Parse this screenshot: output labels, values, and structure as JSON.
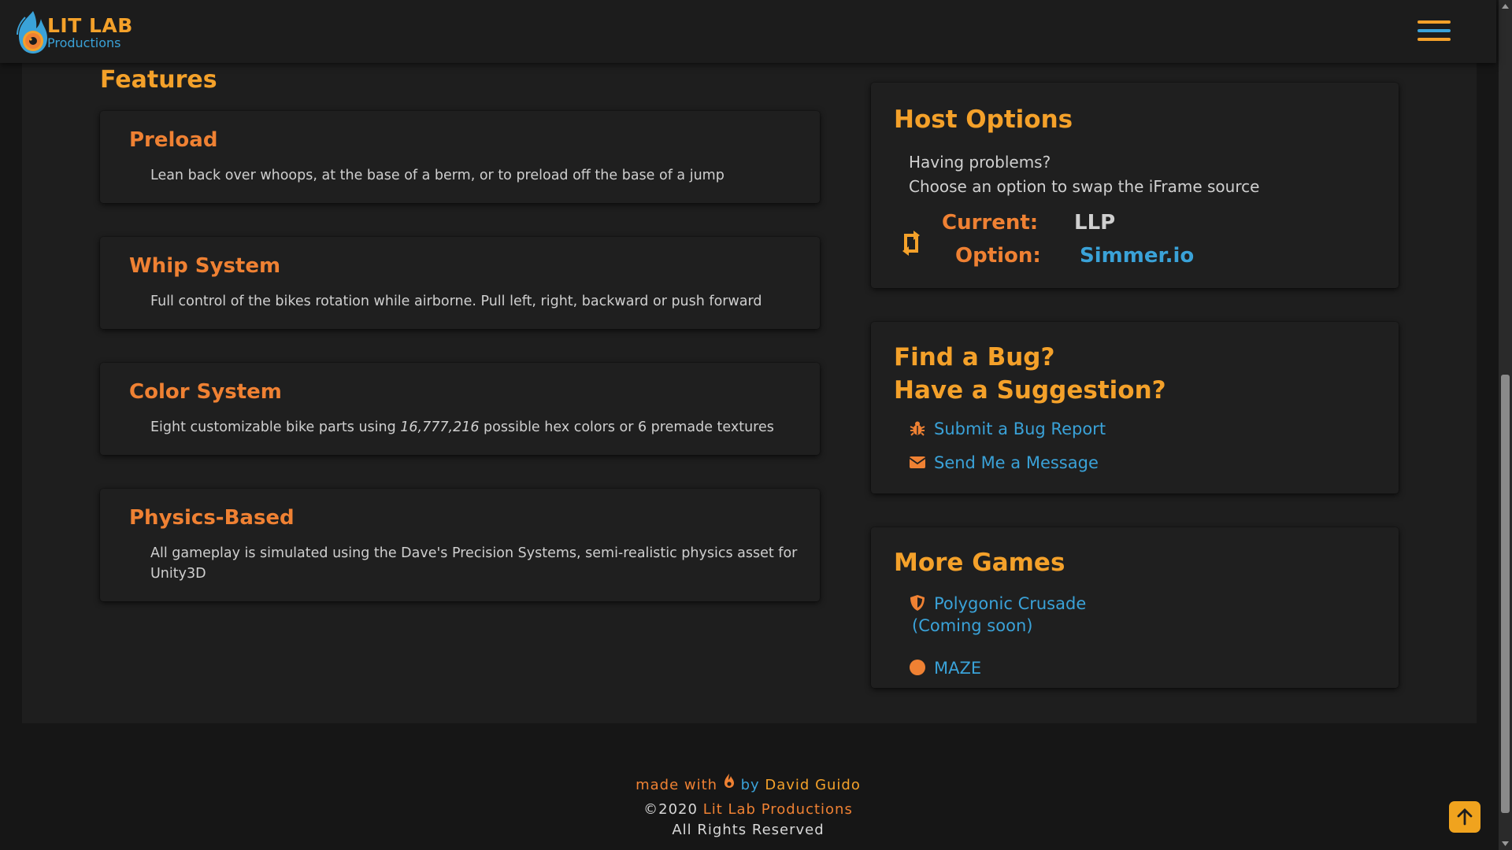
{
  "header": {
    "logo_title": "LIT LAB",
    "logo_subtitle": "Productions",
    "menu_icon": "hamburger-icon"
  },
  "features": {
    "heading": "Features",
    "items": [
      {
        "title": "Preload",
        "desc": "Lean back over whoops, at the base of a berm, or to preload off the base of a jump"
      },
      {
        "title": "Whip System",
        "desc": "Full control of the bikes rotation while airborne. Pull left, right, backward or push forward"
      },
      {
        "title": "Color System",
        "desc_before": "Eight customizable bike parts using ",
        "desc_em": "16,777,216",
        "desc_after": " possible hex colors or 6 premade textures"
      },
      {
        "title": "Physics-Based",
        "desc": "All gameplay is simulated using the Dave's Precision Systems, semi-realistic physics asset for Unity3D"
      }
    ]
  },
  "host": {
    "heading": "Host Options",
    "line1": "Having problems?",
    "line2": "Choose an option to swap the iFrame source",
    "current_label": "Current:",
    "current_value": "LLP",
    "option_label": "Option:",
    "option_value": "Simmer.io",
    "swap_icon": "swap-icon"
  },
  "bug": {
    "heading_line1": "Find a Bug?",
    "heading_line2": "Have a Suggestion?",
    "links": [
      {
        "label": "Submit a Bug Report",
        "icon": "bug-icon"
      },
      {
        "label": "Send Me a Message",
        "icon": "envelope-icon"
      }
    ]
  },
  "games": {
    "heading": "More Games",
    "items": [
      {
        "label": "Polygonic Crusade",
        "sub": "(Coming soon)",
        "icon": "shield-icon"
      },
      {
        "label": "MAZE",
        "icon": "circle-icon"
      }
    ]
  },
  "footer": {
    "made": "made with",
    "by": "by",
    "author": "David Guido",
    "copyright": "©2020",
    "company": "Lit Lab Productions",
    "rights": "All Rights Reserved",
    "flame_icon": "flame-icon"
  },
  "colors": {
    "orange": "#ef8133",
    "yellow": "#f4a12a",
    "blue": "#3aa2d8",
    "background": "#161616",
    "panel": "#1e1e1e"
  }
}
